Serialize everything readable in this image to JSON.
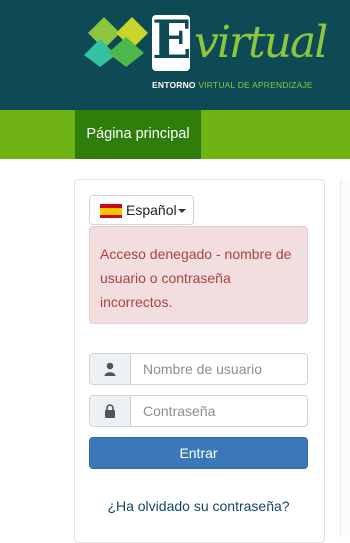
{
  "header": {
    "logo_letter": "E",
    "logo_script": "virtual",
    "tagline_strong": "ENTORNO",
    "tagline_light": "VIRTUAL DE APRENDIZAJE"
  },
  "nav": {
    "home_label": "Página principal"
  },
  "language": {
    "selected": "Español",
    "flag_icon": "spain-flag-icon"
  },
  "alert": {
    "message": "Acceso denegado - nombre de usuario o contraseña incorrectos."
  },
  "login": {
    "username_placeholder": "Nombre de usuario",
    "username_value": "",
    "password_placeholder": "Contraseña",
    "password_value": "",
    "submit_label": "Entrar",
    "forgot_label": "¿Ha olvidado su contraseña?"
  },
  "colors": {
    "header_bg": "#0e4a55",
    "navbar_bg": "#6fb315",
    "nav_active_bg": "#2f7d0a",
    "button_bg": "#3b78b9",
    "alert_bg": "#f2dede",
    "alert_text": "#a94442"
  }
}
